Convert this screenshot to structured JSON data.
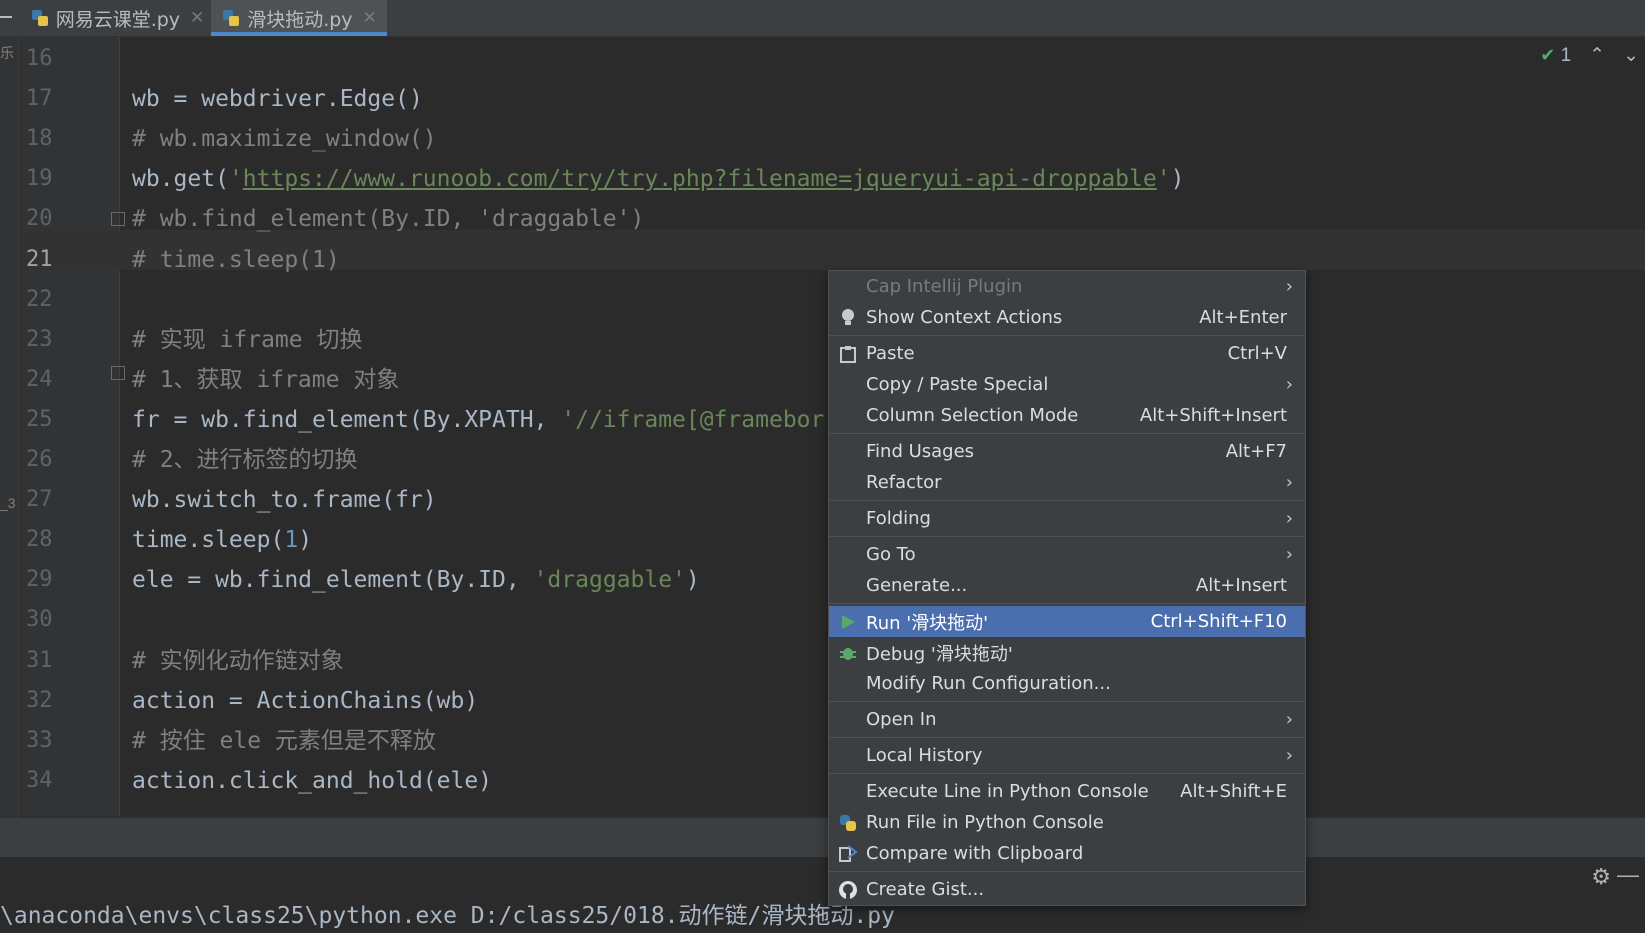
{
  "tabs": [
    {
      "label": "网易云课堂.py",
      "active": false
    },
    {
      "label": "滑块拖动.py",
      "active": true
    }
  ],
  "inspection": {
    "count": "1"
  },
  "code_lines": [
    {
      "num": "16",
      "segments": []
    },
    {
      "num": "17",
      "segments": [
        {
          "t": "wb = webdriver.Edge()",
          "c": "plain"
        }
      ]
    },
    {
      "num": "18",
      "segments": [
        {
          "t": "# wb.maximize_window()",
          "c": "cm"
        }
      ]
    },
    {
      "num": "19",
      "segments": [
        {
          "t": "wb.get(",
          "c": "plain"
        },
        {
          "t": "'",
          "c": "str"
        },
        {
          "t": "https://www.runoob.com/try/try.php?filename=jqueryui-api-droppable",
          "c": "url"
        },
        {
          "t": "'",
          "c": "str"
        },
        {
          "t": ")",
          "c": "plain"
        }
      ]
    },
    {
      "num": "20",
      "segments": [
        {
          "t": "# wb.find_element(By.ID, 'draggable')",
          "c": "cm"
        }
      ]
    },
    {
      "num": "21",
      "segments": [
        {
          "t": "# time.sleep(1)",
          "c": "cm"
        }
      ]
    },
    {
      "num": "22",
      "segments": []
    },
    {
      "num": "23",
      "segments": [
        {
          "t": "# 实现 iframe 切换",
          "c": "cm"
        }
      ]
    },
    {
      "num": "24",
      "segments": [
        {
          "t": "# 1、获取 iframe 对象",
          "c": "cm"
        }
      ]
    },
    {
      "num": "25",
      "segments": [
        {
          "t": "fr = wb.find_element(By.XPATH, ",
          "c": "plain"
        },
        {
          "t": "'//iframe[@framebor",
          "c": "str"
        }
      ]
    },
    {
      "num": "26",
      "segments": [
        {
          "t": "# 2、进行标签的切换",
          "c": "cm"
        }
      ]
    },
    {
      "num": "27",
      "segments": [
        {
          "t": "wb.switch_to.frame(fr)",
          "c": "plain"
        }
      ]
    },
    {
      "num": "28",
      "segments": [
        {
          "t": "time.sleep(",
          "c": "plain"
        },
        {
          "t": "1",
          "c": "num"
        },
        {
          "t": ")",
          "c": "plain"
        }
      ]
    },
    {
      "num": "29",
      "segments": [
        {
          "t": "ele = wb.find_element(By.ID, ",
          "c": "plain"
        },
        {
          "t": "'draggable'",
          "c": "str"
        },
        {
          "t": ")",
          "c": "plain"
        }
      ]
    },
    {
      "num": "30",
      "segments": []
    },
    {
      "num": "31",
      "segments": [
        {
          "t": "# 实例化动作链对象",
          "c": "cm"
        }
      ]
    },
    {
      "num": "32",
      "segments": [
        {
          "t": "action = ActionChains(wb)",
          "c": "plain"
        }
      ]
    },
    {
      "num": "33",
      "segments": [
        {
          "t": "# 按住 ele 元素但是不释放",
          "c": "cm"
        }
      ]
    },
    {
      "num": "34",
      "segments": [
        {
          "t": "action.click_and_hold(ele)",
          "c": "plain"
        }
      ]
    }
  ],
  "current_line": "21",
  "context_menu": {
    "items": [
      {
        "label": "Cap Intellij Plugin",
        "shortcut": "",
        "submenu": true,
        "disabled": true,
        "icon": ""
      },
      {
        "label": "Show Context Actions",
        "shortcut": "Alt+Enter",
        "submenu": false,
        "icon": "bulb-icon"
      },
      {
        "sep": true
      },
      {
        "label": "Paste",
        "shortcut": "Ctrl+V",
        "submenu": false,
        "icon": "clipboard-icon"
      },
      {
        "label": "Copy / Paste Special",
        "shortcut": "",
        "submenu": true,
        "icon": ""
      },
      {
        "label": "Column Selection Mode",
        "shortcut": "Alt+Shift+Insert",
        "submenu": false,
        "icon": ""
      },
      {
        "sep": true
      },
      {
        "label": "Find Usages",
        "shortcut": "Alt+F7",
        "submenu": false,
        "icon": ""
      },
      {
        "label": "Refactor",
        "shortcut": "",
        "submenu": true,
        "icon": ""
      },
      {
        "sep": true
      },
      {
        "label": "Folding",
        "shortcut": "",
        "submenu": true,
        "icon": ""
      },
      {
        "sep": true
      },
      {
        "label": "Go To",
        "shortcut": "",
        "submenu": true,
        "icon": ""
      },
      {
        "label": "Generate...",
        "shortcut": "Alt+Insert",
        "submenu": false,
        "icon": ""
      },
      {
        "sep": true
      },
      {
        "label": "Run '滑块拖动'",
        "shortcut": "Ctrl+Shift+F10",
        "submenu": false,
        "icon": "run-icon",
        "selected": true
      },
      {
        "label": "Debug '滑块拖动'",
        "shortcut": "",
        "submenu": false,
        "icon": "debug-icon"
      },
      {
        "label": "Modify Run Configuration...",
        "shortcut": "",
        "submenu": false,
        "icon": ""
      },
      {
        "sep": true
      },
      {
        "label": "Open In",
        "shortcut": "",
        "submenu": true,
        "icon": ""
      },
      {
        "sep": true
      },
      {
        "label": "Local History",
        "shortcut": "",
        "submenu": true,
        "icon": ""
      },
      {
        "sep": true
      },
      {
        "label": "Execute Line in Python Console",
        "shortcut": "Alt+Shift+E",
        "submenu": false,
        "icon": ""
      },
      {
        "label": "Run File in Python Console",
        "shortcut": "",
        "submenu": false,
        "icon": "python-icon"
      },
      {
        "label": "Compare with Clipboard",
        "shortcut": "",
        "submenu": false,
        "icon": "compare-icon"
      },
      {
        "sep": true
      },
      {
        "label": "Create Gist...",
        "shortcut": "",
        "submenu": false,
        "icon": "github-icon"
      }
    ]
  },
  "console": {
    "text": "\\anaconda\\envs\\class25\\python.exe D:/class25/018.动作链/滑块拖动.py"
  },
  "left_edge_chars": {
    "top": "乐",
    "mid": "_3"
  }
}
